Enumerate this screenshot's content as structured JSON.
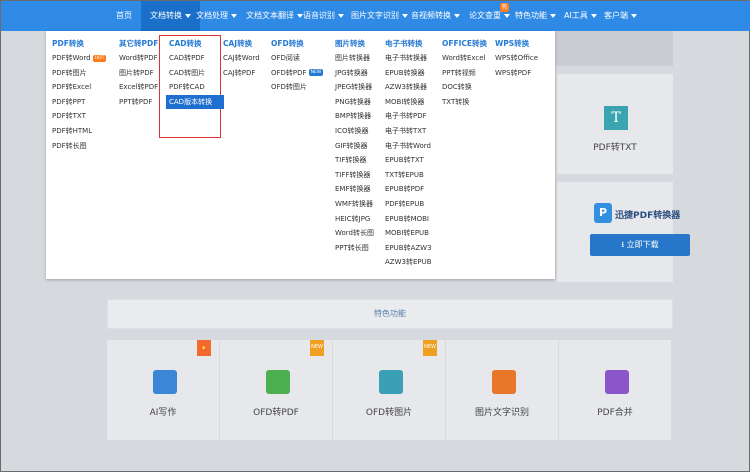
{
  "nav": {
    "items": [
      {
        "label": "首页",
        "caret": false
      },
      {
        "label": "文档转换",
        "caret": true
      },
      {
        "label": "文档处理",
        "caret": true
      },
      {
        "label": "文档文本翻译",
        "caret": true
      },
      {
        "label": "语音识别",
        "caret": true
      },
      {
        "label": "图片文字识别",
        "caret": true
      },
      {
        "label": "音视频转换",
        "caret": true
      },
      {
        "label": "论文查重",
        "caret": true
      },
      {
        "label": "特色功能",
        "caret": true
      },
      {
        "label": "AI工具",
        "caret": true
      },
      {
        "label": "客户端",
        "caret": true
      }
    ],
    "hot_badge": "热"
  },
  "dropdown": {
    "columns": [
      {
        "head": "PDF转换",
        "items": [
          "PDF转Word",
          "PDF转图片",
          "PDF转Excel",
          "PDF转PPT",
          "PDF转TXT",
          "PDF转HTML",
          "PDF转长图"
        ],
        "tags": {
          "0": "hot"
        }
      },
      {
        "head": "其它转PDF",
        "items": [
          "Word转PDF",
          "图片转PDF",
          "Excel转PDF",
          "PPT转PDF"
        ]
      },
      {
        "head": "CAD转换",
        "items": [
          "CAD转PDF",
          "CAD转图片",
          "PDF转CAD",
          "CAD版本转换"
        ]
      },
      {
        "head": "CAJ转换",
        "items": [
          "CAJ转Word",
          "CAJ转PDF"
        ]
      },
      {
        "head": "OFD转换",
        "items": [
          "OFD阅读",
          "OFD转PDF",
          "OFD转图片"
        ],
        "tags": {
          "1": "new"
        }
      },
      {
        "head": "图片转换",
        "items": [
          "图片转换器",
          "JPG转换器",
          "JPEG转换器",
          "PNG转换器",
          "BMP转换器",
          "ICO转换器",
          "GIF转换器",
          "TIF转换器",
          "TIFF转换器",
          "EMF转换器",
          "WMF转换器",
          "HEIC转JPG",
          "Word转长图",
          "PPT转长图"
        ]
      },
      {
        "head": "电子书转换",
        "items": [
          "电子书转换器",
          "EPUB转换器",
          "AZW3转换器",
          "MOBI转换器",
          "电子书转PDF",
          "电子书转TXT",
          "电子书转Word",
          "EPUB转TXT",
          "TXT转EPUB",
          "EPUB转PDF",
          "PDF转EPUB",
          "EPUB转MOBI",
          "MOBI转EPUB",
          "EPUB转AZW3",
          "AZW3转EPUB"
        ]
      },
      {
        "head": "OFFICE转换",
        "items": [
          "Word转Excel",
          "PPT转视频",
          "DOC转换",
          "TXT转换"
        ]
      },
      {
        "head": "WPS转换",
        "items": [
          "WPS转Office",
          "WPS转PDF"
        ]
      }
    ],
    "highlighted": "CAD版本转换",
    "tag_labels": {
      "hot": "HOT",
      "new": "NEW"
    }
  },
  "page": {
    "pdf_txt_label": "PDF转TXT",
    "pdf_txt_icon": "T",
    "promo": {
      "logo": "P",
      "brand": "迅捷PDF转换器",
      "download": "立即下载"
    },
    "feature_strip": "特色功能",
    "features": [
      {
        "label": "AI写作",
        "color": "#3b86d6",
        "corner": "🔥",
        "corner_type": "hot"
      },
      {
        "label": "OFD转PDF",
        "color": "#4caf50",
        "corner": "NEW",
        "corner_type": "new"
      },
      {
        "label": "OFD转图片",
        "color": "#3aa0b5",
        "corner": "NEW",
        "corner_type": "new"
      },
      {
        "label": "图片文字识别",
        "color": "#e9772a",
        "corner": "",
        "corner_type": ""
      },
      {
        "label": "PDF合并",
        "color": "#8a56c9",
        "corner": "",
        "corner_type": ""
      }
    ]
  },
  "colors": {
    "nav_bg": "#2f8ae6",
    "accent": "#2479d2",
    "highlight_border": "#e03030"
  }
}
